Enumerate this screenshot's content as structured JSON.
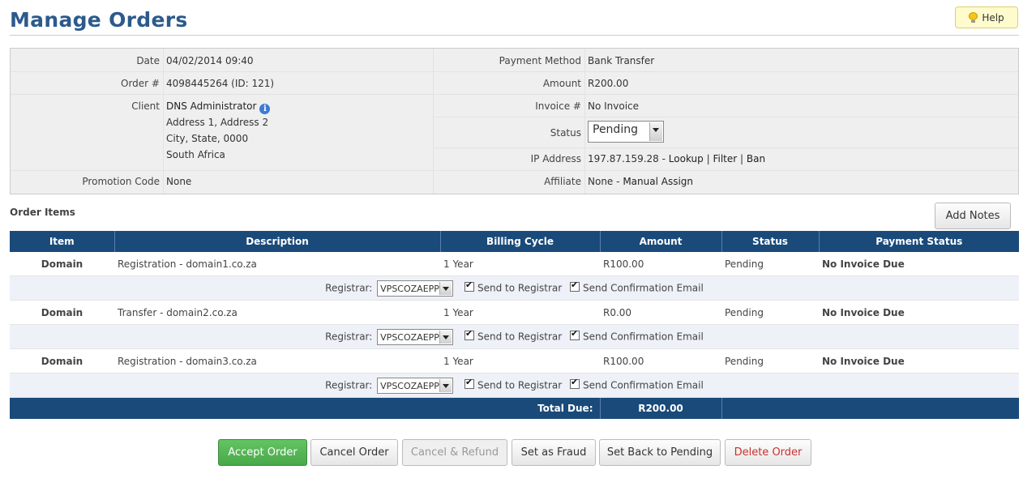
{
  "page": {
    "title": "Manage Orders",
    "help_label": "Help"
  },
  "order": {
    "date_label": "Date",
    "date": "04/02/2014 09:40",
    "order_label": "Order #",
    "order_number": "4098445264 (ID: 121)",
    "client_label": "Client",
    "client_name": "DNS Administrator",
    "client_address": [
      "Address 1, Address 2",
      "City, State, 0000",
      "South Africa"
    ],
    "promo_label": "Promotion Code",
    "promo": "None",
    "payment_label": "Payment Method",
    "payment_method": "Bank Transfer",
    "amount_label": "Amount",
    "amount": "R200.00",
    "invoice_label": "Invoice #",
    "invoice": "No Invoice",
    "status_label": "Status",
    "status": "Pending",
    "ip_label": "IP Address",
    "ip": "197.87.159.28",
    "ip_sep": "-",
    "ip_lookup": "Lookup",
    "ip_filter": "Filter",
    "ip_ban": "Ban",
    "pipe": "|",
    "affiliate_label": "Affiliate",
    "affiliate": "None",
    "affiliate_sep": "-",
    "affiliate_assign": "Manual Assign"
  },
  "items": {
    "section_title": "Order Items",
    "add_notes_label": "Add Notes",
    "columns": [
      "Item",
      "Description",
      "Billing Cycle",
      "Amount",
      "Status",
      "Payment Status"
    ],
    "rows": [
      {
        "item": "Domain",
        "description": "Registration - domain1.co.za",
        "cycle": "1 Year",
        "amount": "R100.00",
        "status": "Pending",
        "payment": "No Invoice Due"
      },
      {
        "item": "Domain",
        "description": "Transfer - domain2.co.za",
        "cycle": "1 Year",
        "amount": "R0.00",
        "status": "Pending",
        "payment": "No Invoice Due"
      },
      {
        "item": "Domain",
        "description": "Registration - domain3.co.za",
        "cycle": "1 Year",
        "amount": "R100.00",
        "status": "Pending",
        "payment": "No Invoice Due"
      }
    ],
    "registrar_label": "Registrar:",
    "registrar_value": "VPSCOZAEPP",
    "send_registrar_label": "Send to Registrar",
    "send_email_label": "Send Confirmation Email",
    "total_label": "Total Due:",
    "total_value": "R200.00"
  },
  "actions": {
    "accept": "Accept Order",
    "cancel": "Cancel Order",
    "cancel_refund": "Cancel & Refund",
    "fraud": "Set as Fraud",
    "pending": "Set Back to Pending",
    "delete": "Delete Order"
  },
  "colors": {
    "title": "#2c5a8c",
    "header": "#1a4a7a",
    "accept": "#5cb85c",
    "delete": "#c9302c",
    "payment_ok": "#6d8f00"
  }
}
